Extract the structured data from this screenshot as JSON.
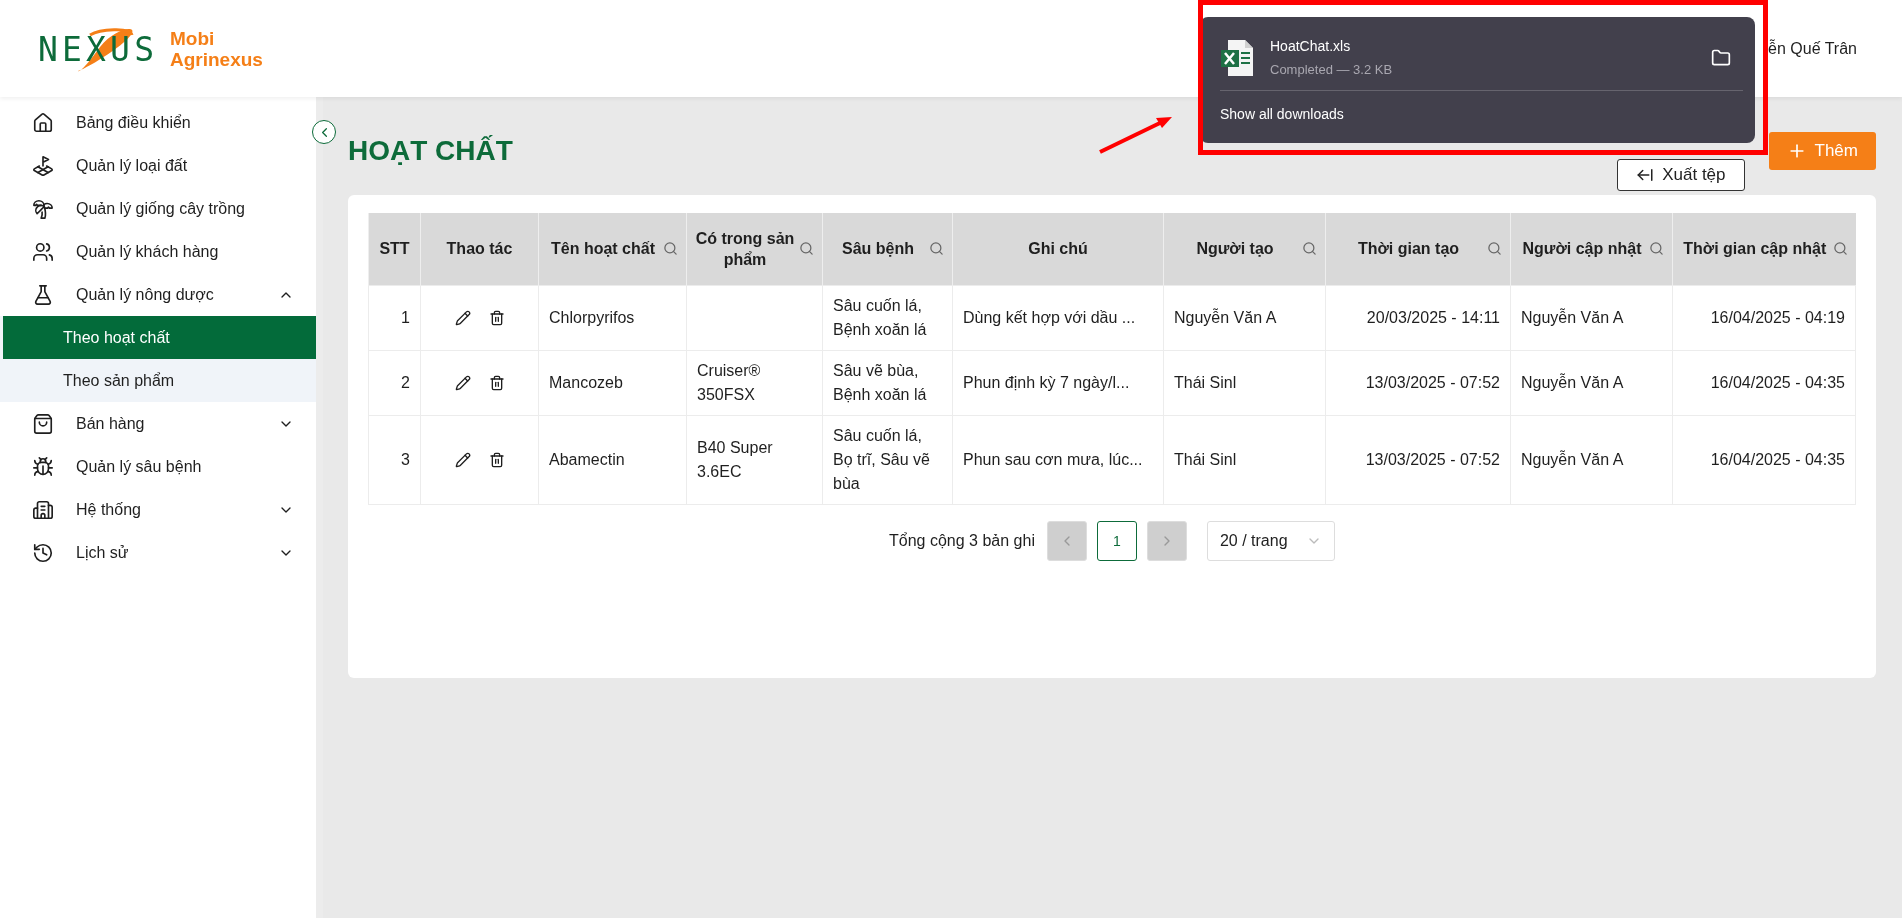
{
  "logo": {
    "mark": "NEXUS",
    "name_line1": "Mobi",
    "name_line2": "Agrinexus"
  },
  "sidebar": {
    "items": [
      {
        "label": "Bảng điều khiển"
      },
      {
        "label": "Quản lý loại đất"
      },
      {
        "label": "Quản lý giống cây trồng"
      },
      {
        "label": "Quản lý khách hàng"
      },
      {
        "label": "Quản lý nông dược",
        "expanded": true,
        "children": [
          {
            "label": "Theo hoạt chất",
            "selected": true
          },
          {
            "label": "Theo sản phẩm",
            "selected": false
          }
        ]
      },
      {
        "label": "Bán hàng",
        "expanded": false
      },
      {
        "label": "Quản lý sâu bệnh"
      },
      {
        "label": "Hệ thống",
        "expanded": false
      },
      {
        "label": "Lịch sử",
        "expanded": false
      }
    ]
  },
  "header": {
    "user_name": "ễn Quế Trân"
  },
  "download_popup": {
    "file_name": "HoatChat.xls",
    "status": "Completed — 3.2 KB",
    "link": "Show all downloads"
  },
  "page": {
    "title": "HOẠT CHẤT",
    "buttons": [
      {
        "label": "Xuất tệp",
        "kind": "export"
      },
      {
        "label": "Thêm",
        "kind": "add"
      }
    ]
  },
  "table": {
    "columns": [
      {
        "label": "STT",
        "searchable": false
      },
      {
        "label": "Thao tác",
        "searchable": false
      },
      {
        "label": "Tên hoạt chất",
        "searchable": true
      },
      {
        "label": "Có trong sản phẩm",
        "searchable": true
      },
      {
        "label": "Sâu bệnh",
        "searchable": true
      },
      {
        "label": "Ghi chú",
        "searchable": false
      },
      {
        "label": "Người tạo",
        "searchable": true
      },
      {
        "label": "Thời gian tạo",
        "searchable": true
      },
      {
        "label": "Người cập nhật",
        "searchable": true
      },
      {
        "label": "Thời gian cập nhật",
        "searchable": true
      }
    ],
    "rows": [
      {
        "stt": "1",
        "name": "Chlorpyrifos",
        "pests": "Sâu cuốn lá, Bệnh xoăn lá",
        "note": "Dùng kết hợp với dầu ...",
        "creator": "Nguyễn Văn A",
        "created": "20/03/2025 - 14:11",
        "updater": "Nguyễn Văn A",
        "updated": "16/04/2025 - 04:19"
      },
      {
        "stt": "2",
        "name": "Mancozeb",
        "products": "Cruiser® 350FSX",
        "pests": "Sâu vẽ bùa, Bệnh xoăn lá",
        "note": "Phun định kỳ 7 ngày/l...",
        "creator": "Thái Sinl",
        "created": "13/03/2025 - 07:52",
        "updater": "Nguyễn Văn A",
        "updated": "16/04/2025 - 04:35"
      },
      {
        "stt": "3",
        "name": "Abamectin",
        "products": "B40 Super 3.6EC",
        "pests": "Sâu cuốn lá, Bọ trĩ, Sâu vẽ bùa",
        "note": "Phun sau cơn mưa, lúc...",
        "creator": "Thái Sinl",
        "created": "13/03/2025 - 07:52",
        "updater": "Nguyễn Văn A",
        "updated": "16/04/2025 - 04:35"
      }
    ]
  },
  "pagination": {
    "total": "Tổng cộng 3 bản ghi",
    "prev_disabled": true,
    "next_disabled": true,
    "pages": [
      {
        "label": "1",
        "selected": true
      }
    ],
    "page_size": "20 / trang"
  }
}
